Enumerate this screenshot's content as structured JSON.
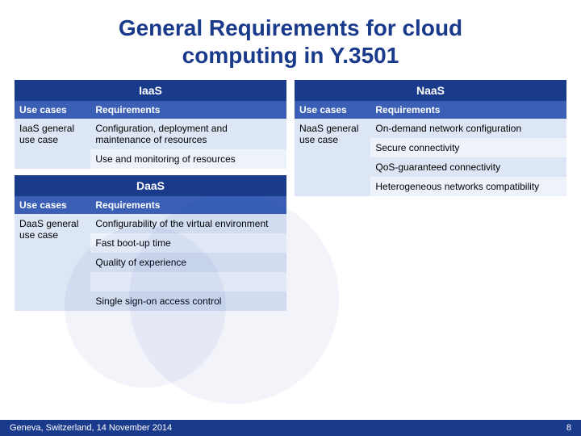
{
  "title": {
    "line1": "General Requirements for cloud",
    "line2": "computing in Y.3501"
  },
  "iaas": {
    "section_label": "IaaS",
    "col_use_cases": "Use cases",
    "col_requirements": "Requirements",
    "use_case_label": "IaaS general use case",
    "requirements": [
      "Configuration, deployment and maintenance of resources",
      "Use and monitoring of resources"
    ]
  },
  "daas": {
    "section_label": "DaaS",
    "col_use_cases": "Use cases",
    "col_requirements": "Requirements",
    "use_case_label": "DaaS general use case",
    "requirements": [
      "Configurability of the virtual environment",
      "Fast boot-up time",
      "Quality of experience",
      "",
      "Single sign-on access control"
    ]
  },
  "naas": {
    "section_label": "NaaS",
    "col_use_cases": "Use cases",
    "col_requirements": "Requirements",
    "use_case_label": "NaaS general use case",
    "requirements": [
      "On-demand network configuration",
      "Secure connectivity",
      "QoS-guaranteed connectivity",
      "Heterogeneous networks compatibility"
    ]
  },
  "footer": {
    "left": "Geneva, Switzerland, 14 November 2014",
    "right": "8"
  }
}
